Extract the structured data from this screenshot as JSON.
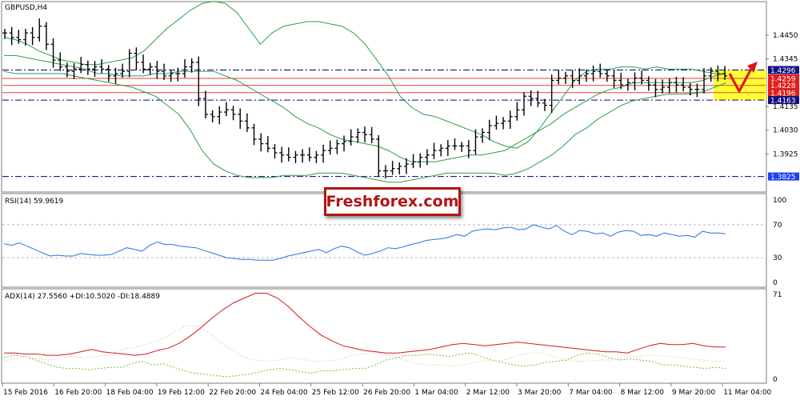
{
  "chart_data": [
    {
      "type": "candlestick",
      "title": "GBPUSD,H4",
      "ylim": [
        1.376,
        1.4595
      ],
      "y_ticks": [
        "1.4450",
        "1.4345",
        "1.4135",
        "1.4030",
        "1.3925"
      ],
      "price_levels": [
        {
          "label": "1.4296",
          "value": 1.4296,
          "style": "dashdot",
          "color": "#000080"
        },
        {
          "label": "1.4259",
          "value": 1.4259,
          "style": "solid",
          "color": "#e04040"
        },
        {
          "label": "1.4228",
          "value": 1.4228,
          "style": "solid",
          "color": "#e04040"
        },
        {
          "label": "1.4196",
          "value": 1.4196,
          "style": "solid",
          "color": "#e04040"
        },
        {
          "label": "1.4163",
          "value": 1.4163,
          "style": "dashdot",
          "color": "#000080"
        },
        {
          "label": "1.3825",
          "value": 1.3825,
          "style": "dashdot",
          "color": "#000080"
        }
      ],
      "series": [
        {
          "kind": "bollinger_upper",
          "color": "#2e9e4a",
          "values": [
            1.444,
            1.443,
            1.441,
            1.438,
            1.436,
            1.434,
            1.433,
            1.432,
            1.432,
            1.433,
            1.434,
            1.435,
            1.438,
            1.443,
            1.448,
            1.452,
            1.456,
            1.459,
            1.46,
            1.459,
            1.455,
            1.448,
            1.441,
            1.446,
            1.449,
            1.45,
            1.451,
            1.451,
            1.45,
            1.449,
            1.446,
            1.441,
            1.434,
            1.427,
            1.418,
            1.413,
            1.41,
            1.409,
            1.407,
            1.405,
            1.403,
            1.401,
            1.398,
            1.396,
            1.395,
            1.398,
            1.404,
            1.411,
            1.418,
            1.425,
            1.429,
            1.43,
            1.43,
            1.431,
            1.431,
            1.43,
            1.431,
            1.43,
            1.43,
            1.43,
            1.429,
            1.428,
            1.428
          ]
        },
        {
          "kind": "bollinger_middle",
          "color": "#2e9e4a",
          "values": [
            1.436,
            1.436,
            1.435,
            1.434,
            1.433,
            1.432,
            1.431,
            1.43,
            1.428,
            1.428,
            1.427,
            1.427,
            1.427,
            1.428,
            1.428,
            1.429,
            1.429,
            1.429,
            1.429,
            1.427,
            1.425,
            1.422,
            1.419,
            1.416,
            1.413,
            1.409,
            1.406,
            1.404,
            1.401,
            1.399,
            1.398,
            1.397,
            1.396,
            1.394,
            1.391,
            1.389,
            1.389,
            1.389,
            1.39,
            1.391,
            1.392,
            1.392,
            1.393,
            1.394,
            1.397,
            1.4,
            1.403,
            1.406,
            1.41,
            1.413,
            1.416,
            1.419,
            1.421,
            1.422,
            1.424,
            1.424,
            1.424,
            1.424,
            1.424,
            1.424,
            1.425,
            1.427,
            1.428
          ]
        },
        {
          "kind": "bollinger_lower",
          "color": "#2e9e4a",
          "values": [
            1.429,
            1.428,
            1.428,
            1.428,
            1.428,
            1.428,
            1.427,
            1.426,
            1.425,
            1.424,
            1.423,
            1.422,
            1.42,
            1.418,
            1.414,
            1.41,
            1.403,
            1.394,
            1.388,
            1.385,
            1.383,
            1.382,
            1.382,
            1.382,
            1.383,
            1.383,
            1.383,
            1.384,
            1.384,
            1.384,
            1.383,
            1.382,
            1.381,
            1.38,
            1.38,
            1.381,
            1.382,
            1.383,
            1.384,
            1.384,
            1.384,
            1.384,
            1.384,
            1.383,
            1.384,
            1.386,
            1.389,
            1.392,
            1.396,
            1.401,
            1.404,
            1.408,
            1.411,
            1.414,
            1.416,
            1.417,
            1.418,
            1.419,
            1.419,
            1.419,
            1.42,
            1.422,
            1.424
          ]
        },
        {
          "kind": "price",
          "values": [
            1.446,
            1.444,
            1.443,
            1.446,
            1.444,
            1.449,
            1.441,
            1.434,
            1.431,
            1.429,
            1.43,
            1.432,
            1.43,
            1.431,
            1.43,
            1.427,
            1.428,
            1.429,
            1.437,
            1.433,
            1.43,
            1.431,
            1.429,
            1.427,
            1.428,
            1.428,
            1.431,
            1.433,
            1.417,
            1.41,
            1.409,
            1.411,
            1.412,
            1.41,
            1.407,
            1.404,
            1.399,
            1.397,
            1.395,
            1.393,
            1.392,
            1.391,
            1.392,
            1.392,
            1.391,
            1.392,
            1.394,
            1.395,
            1.397,
            1.398,
            1.4,
            1.402,
            1.401,
            1.399,
            1.385,
            1.385,
            1.386,
            1.387,
            1.388,
            1.389,
            1.391,
            1.392,
            1.394,
            1.395,
            1.396,
            1.396,
            1.396,
            1.394,
            1.4,
            1.402,
            1.405,
            1.406,
            1.407,
            1.409,
            1.412,
            1.418,
            1.417,
            1.415,
            1.414,
            1.425,
            1.426,
            1.427,
            1.425,
            1.427,
            1.428,
            1.429,
            1.428,
            1.427,
            1.425,
            1.423,
            1.424,
            1.426,
            1.425,
            1.423,
            1.421,
            1.422,
            1.424,
            1.423,
            1.422,
            1.421,
            1.421,
            1.427,
            1.429,
            1.428,
            1.427
          ]
        }
      ]
    },
    {
      "type": "line",
      "title": "RSI(14) 59.9619",
      "ylim": [
        0,
        100
      ],
      "y_ticks": [
        "100",
        "70",
        "30",
        "0"
      ],
      "levels": [
        70,
        30
      ],
      "series": [
        {
          "kind": "rsi",
          "color": "#1e78e0",
          "values": [
            47,
            45,
            48,
            44,
            40,
            36,
            32,
            33,
            32,
            32,
            35,
            34,
            33,
            33,
            34,
            38,
            42,
            40,
            38,
            45,
            49,
            46,
            46,
            44,
            43,
            42,
            39,
            36,
            33,
            30,
            29,
            28,
            28,
            27,
            27,
            27,
            29,
            32,
            34,
            36,
            38,
            40,
            36,
            41,
            44,
            42,
            37,
            33,
            35,
            38,
            42,
            41,
            43,
            46,
            48,
            51,
            52,
            53,
            55,
            58,
            56,
            62,
            64,
            65,
            64,
            66,
            67,
            64,
            65,
            70,
            67,
            65,
            69,
            62,
            58,
            63,
            62,
            59,
            60,
            56,
            61,
            63,
            62,
            57,
            58,
            56,
            60,
            58,
            56,
            57,
            55,
            62,
            60,
            60,
            59
          ]
        }
      ]
    },
    {
      "type": "line",
      "title": "ADX(14) 27.5560 +DI:10.5020 -DI:18.4889",
      "ylim": [
        0,
        71
      ],
      "y_ticks": [
        "71",
        "0"
      ],
      "series": [
        {
          "kind": "adx",
          "color": "#d21c1c",
          "values": [
            22,
            22,
            21,
            21,
            20,
            20,
            21,
            23,
            25,
            23,
            22,
            21,
            20,
            21,
            24,
            26,
            30,
            36,
            43,
            51,
            58,
            64,
            68,
            72,
            72,
            68,
            61,
            52,
            44,
            37,
            32,
            28,
            26,
            24,
            23,
            22,
            22,
            23,
            24,
            25,
            27,
            29,
            30,
            29,
            28,
            29,
            30,
            31,
            30,
            29,
            28,
            27,
            26,
            25,
            24,
            23,
            23,
            22,
            25,
            28,
            30,
            29,
            29,
            30,
            28,
            27,
            27
          ]
        },
        {
          "kind": "plus_di",
          "color": "#7bbf3a",
          "values": [
            18,
            20,
            19,
            16,
            13,
            10,
            9,
            9,
            8,
            9,
            10,
            10,
            13,
            15,
            12,
            13,
            10,
            7,
            5,
            4,
            3,
            2,
            3,
            4,
            6,
            8,
            9,
            8,
            6,
            5,
            7,
            7,
            8,
            9,
            9,
            12,
            16,
            18,
            20,
            20,
            21,
            20,
            19,
            21,
            22,
            19,
            16,
            14,
            12,
            11,
            12,
            14,
            15,
            16,
            20,
            22,
            21,
            18,
            16,
            17,
            16,
            15,
            12,
            12,
            11,
            10,
            9,
            10,
            9
          ]
        },
        {
          "kind": "minus_di",
          "color": "#e8d2bf",
          "values": [
            15,
            17,
            19,
            17,
            16,
            18,
            19,
            18,
            19,
            20,
            24,
            26,
            28,
            31,
            34,
            40,
            45,
            44,
            38,
            30,
            24,
            18,
            16,
            15,
            16,
            18,
            17,
            15,
            15,
            16,
            19,
            21,
            22,
            21,
            19,
            16,
            13,
            12,
            12,
            11,
            12,
            14,
            16,
            15,
            17,
            20,
            22,
            22,
            19,
            16,
            15,
            15,
            16,
            16,
            18,
            19,
            20,
            20,
            19,
            18,
            17,
            16,
            15,
            15
          ]
        }
      ]
    }
  ],
  "time_labels": [
    "15 Feb 2016",
    "16 Feb 20:00",
    "18 Feb 04:00",
    "19 Feb 12:00",
    "22 Feb 20:00",
    "24 Feb 04:00",
    "25 Feb 12:00",
    "26 Feb 20:00",
    "1 Mar 04:00",
    "2 Mar 12:00",
    "3 Mar 20:00",
    "7 Mar 04:00",
    "8 Mar 12:00",
    "9 Mar 20:00",
    "11 Mar 04:00"
  ],
  "watermark": "Freshforex.com",
  "colors": {
    "frame": "#7c7c7c",
    "grid": "#c8c8c8",
    "level_blue": "#000080",
    "level_red": "#e04040",
    "zone_yellow": "#ffff33",
    "arrow_red": "#e01414",
    "candle": "#000000",
    "tag_red": "#e21f1f",
    "tag_navy": "#101080",
    "tag_blue": "#1b3ff0",
    "watermark_red": "#b01616"
  }
}
